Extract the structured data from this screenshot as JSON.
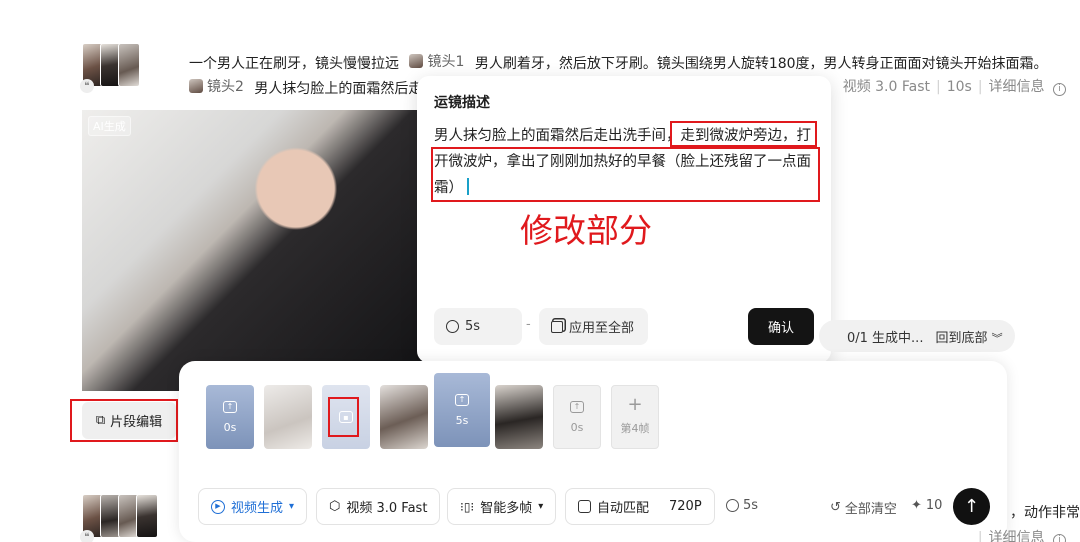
{
  "shot1": {
    "prompt_line1": "一个男人正在刷牙，镜头慢慢拉远",
    "tag1": "镜头1",
    "prompt_line1_rest": "男人刷着牙，然后放下牙刷。镜头围绕男人旋转180度，男人转身正面面对镜头开始抹面霜。",
    "tag2": "镜头2",
    "prompt_line2": "男人抹匀脸上的面霜然后走",
    "model": "视频 3.0 Fast",
    "duration": "10s",
    "detail": "详细信息",
    "ai_badge": "AI生成"
  },
  "popup": {
    "title": "运镜描述",
    "text": "男人抹匀脸上的面霜然后走出洗手间，走到微波炉旁边，打开微波炉，拿出了刚刚加热好的早餐（脸上还残留了一点面霜）",
    "annotation": "修改部分",
    "duration_chip": "5s",
    "dash": "-",
    "apply_all": "应用至全部",
    "confirm": "确认"
  },
  "progress": {
    "status": "0/1 生成中...",
    "to_bottom": "回到底部"
  },
  "edit_button": "片段编辑",
  "frames": {
    "f1": "0s",
    "f2": "5s",
    "f3": "0s",
    "f4": "第4帧"
  },
  "toolbar": {
    "mode": "视频生成",
    "model": "视频 3.0 Fast",
    "multi_frame": "智能多帧",
    "ratio": "自动匹配",
    "resolution": "720P",
    "duration": "5s",
    "clear": "全部清空",
    "credits": "10"
  },
  "shot2": {
    "text_right": "，动作非常",
    "detail": "详细信息"
  },
  "colors": {
    "annotation_red": "#e0191d",
    "accent_blue": "#1f6fd6"
  }
}
